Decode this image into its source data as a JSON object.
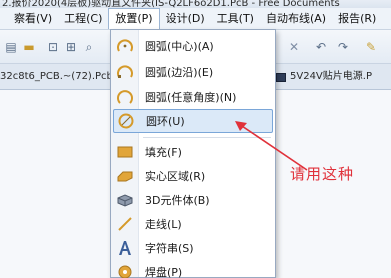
{
  "window": {
    "title": "2.报价2020(4层板)驱动直文件夹(IS-Q2LF6o2D1.PcB - Free Documents"
  },
  "menubar": {
    "items": [
      {
        "label": "察看(V)",
        "active": false
      },
      {
        "label": "工程(C)",
        "active": false
      },
      {
        "label": "放置(P)",
        "active": true
      },
      {
        "label": "设计(D)",
        "active": false
      },
      {
        "label": "工具(T)",
        "active": false
      },
      {
        "label": "自动布线(A)",
        "active": false
      },
      {
        "label": "报告(R)",
        "active": false
      }
    ]
  },
  "doctabs": {
    "left": "32c8t6_PCB.~(72).PcbDc",
    "right": "5V24V贴片电源.P"
  },
  "dropdown": {
    "items": [
      {
        "label": "圆弧(中心)(A)",
        "icon": "arc-center-icon"
      },
      {
        "label": "圆弧(边沿)(E)",
        "icon": "arc-edge-icon"
      },
      {
        "label": "圆弧(任意角度)(N)",
        "icon": "arc-any-angle-icon"
      },
      {
        "label": "圆环(U)",
        "icon": "full-circle-icon",
        "selected": true
      },
      {
        "label": "填充(F)",
        "icon": "fill-icon"
      },
      {
        "label": "实心区域(R)",
        "icon": "solid-region-icon"
      },
      {
        "label": "3D元件体(B)",
        "icon": "3d-body-icon"
      },
      {
        "label": "走线(L)",
        "icon": "line-icon"
      },
      {
        "label": "字符串(S)",
        "icon": "string-icon"
      },
      {
        "label": "焊盘(P)",
        "icon": "pad-icon"
      }
    ]
  },
  "annotation": {
    "text": "请用这种",
    "color": "#e0313a"
  }
}
